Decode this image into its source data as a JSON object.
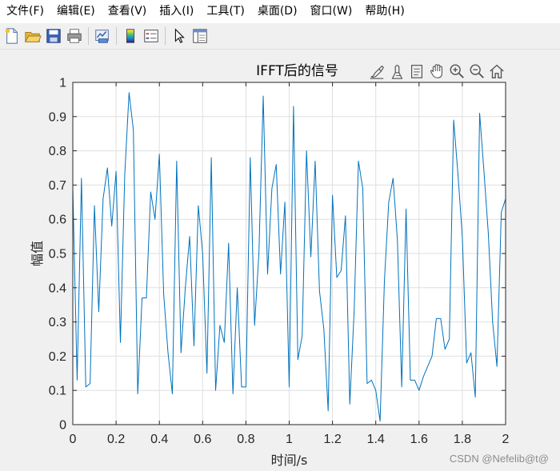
{
  "menu": {
    "items": [
      {
        "label": "文件(F)"
      },
      {
        "label": "编辑(E)"
      },
      {
        "label": "查看(V)"
      },
      {
        "label": "插入(I)"
      },
      {
        "label": "工具(T)"
      },
      {
        "label": "桌面(D)"
      },
      {
        "label": "窗口(W)"
      },
      {
        "label": "帮助(H)"
      }
    ]
  },
  "toolbar": {
    "icons": [
      "new-file-icon",
      "open-folder-icon",
      "save-icon",
      "print-icon",
      "link-plot-icon",
      "insert-colorbar-icon",
      "insert-legend-icon",
      "pointer-icon",
      "property-inspector-icon"
    ]
  },
  "axes_toolbar": {
    "icons": [
      "brush-icon",
      "data-tips-icon",
      "restore-view-icon",
      "pan-icon",
      "zoom-in-icon",
      "zoom-out-icon",
      "home-icon"
    ]
  },
  "colors": {
    "line": "#0072bd",
    "grid": "#dfdfdf",
    "axes_bg": "#ffffff",
    "figure_bg": "#f0f0f0"
  },
  "watermark": "CSDN @Nefelib@t@",
  "chart_data": {
    "type": "line",
    "title": "IFFT后的信号",
    "xlabel": "时间/s",
    "ylabel": "幅值",
    "xlim": [
      0,
      2
    ],
    "ylim": [
      0,
      1
    ],
    "xticks": [
      0,
      0.2,
      0.4,
      0.6,
      0.8,
      1,
      1.2,
      1.4,
      1.6,
      1.8,
      2
    ],
    "yticks": [
      0,
      0.1,
      0.2,
      0.3,
      0.4,
      0.5,
      0.6,
      0.7,
      0.8,
      0.9,
      1
    ],
    "xtick_labels": [
      "0",
      "0.2",
      "0.4",
      "0.6",
      "0.8",
      "1",
      "1.2",
      "1.4",
      "1.6",
      "1.8",
      "2"
    ],
    "ytick_labels": [
      "0",
      "0.1",
      "0.2",
      "0.3",
      "0.4",
      "0.5",
      "0.6",
      "0.7",
      "0.8",
      "0.9",
      "1"
    ],
    "grid": true,
    "series": [
      {
        "x": [
          0.0,
          0.02,
          0.04,
          0.06,
          0.08,
          0.1,
          0.12,
          0.14,
          0.16,
          0.18,
          0.2,
          0.22,
          0.24,
          0.26,
          0.28,
          0.3,
          0.32,
          0.34,
          0.36,
          0.38,
          0.4,
          0.42,
          0.44,
          0.46,
          0.48,
          0.5,
          0.52,
          0.54,
          0.56,
          0.58,
          0.6,
          0.62,
          0.64,
          0.66,
          0.68,
          0.7,
          0.72,
          0.74,
          0.76,
          0.78,
          0.8,
          0.82,
          0.84,
          0.86,
          0.88,
          0.9,
          0.92,
          0.94,
          0.96,
          0.98,
          1.0,
          1.02,
          1.04,
          1.06,
          1.08,
          1.1,
          1.12,
          1.14,
          1.16,
          1.18,
          1.2,
          1.22,
          1.24,
          1.26,
          1.28,
          1.3,
          1.32,
          1.34,
          1.36,
          1.38,
          1.4,
          1.42,
          1.44,
          1.46,
          1.48,
          1.5,
          1.52,
          1.54,
          1.56,
          1.58,
          1.6,
          1.62,
          1.64,
          1.66,
          1.68,
          1.7,
          1.72,
          1.74,
          1.76,
          1.78,
          1.8,
          1.82,
          1.84,
          1.86,
          1.88,
          1.9,
          1.92,
          1.94,
          1.96,
          1.98,
          2.0
        ],
        "y": [
          0.69,
          0.13,
          0.72,
          0.11,
          0.12,
          0.64,
          0.33,
          0.66,
          0.75,
          0.58,
          0.74,
          0.24,
          0.73,
          0.97,
          0.86,
          0.09,
          0.37,
          0.37,
          0.68,
          0.6,
          0.79,
          0.38,
          0.21,
          0.09,
          0.77,
          0.21,
          0.4,
          0.55,
          0.23,
          0.64,
          0.5,
          0.15,
          0.78,
          0.1,
          0.29,
          0.24,
          0.53,
          0.09,
          0.4,
          0.11,
          0.11,
          0.78,
          0.29,
          0.5,
          0.96,
          0.44,
          0.69,
          0.76,
          0.44,
          0.65,
          0.11,
          0.93,
          0.19,
          0.26,
          0.8,
          0.49,
          0.77,
          0.39,
          0.28,
          0.04,
          0.67,
          0.43,
          0.45,
          0.61,
          0.06,
          0.33,
          0.77,
          0.69,
          0.12,
          0.13,
          0.1,
          0.01,
          0.42,
          0.65,
          0.72,
          0.54,
          0.11,
          0.63,
          0.13,
          0.13,
          0.1,
          0.14,
          0.17,
          0.2,
          0.31,
          0.31,
          0.22,
          0.25,
          0.89,
          0.73,
          0.55,
          0.18,
          0.21,
          0.08,
          0.91,
          0.74,
          0.56,
          0.3,
          0.17,
          0.62,
          0.66
        ]
      }
    ]
  }
}
